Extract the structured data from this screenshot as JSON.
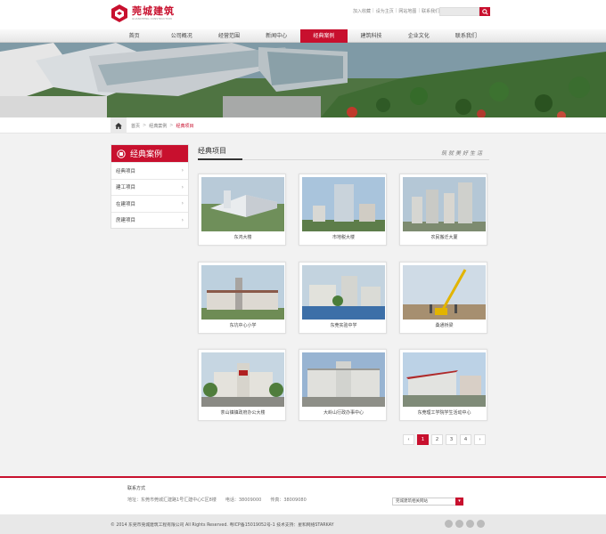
{
  "header": {
    "logo_title": "莞城建筑",
    "logo_subtitle": "GUANCHENG CONSTRUCTION",
    "toplinks": [
      "加入收藏",
      "设为主页",
      "网站地图",
      "联系我们"
    ],
    "search_placeholder": ""
  },
  "nav": {
    "items": [
      {
        "label": "首页",
        "active": false
      },
      {
        "label": "公司概况",
        "active": false
      },
      {
        "label": "经营范围",
        "active": false
      },
      {
        "label": "新闻中心",
        "active": false
      },
      {
        "label": "经典案例",
        "active": true
      },
      {
        "label": "建筑科技",
        "active": false
      },
      {
        "label": "企业文化",
        "active": false
      },
      {
        "label": "联系我们",
        "active": false
      }
    ]
  },
  "breadcrumb": {
    "home": "首页",
    "section": "经典案例",
    "current": "经典项目"
  },
  "sidebar": {
    "title": "经典案例",
    "items": [
      "经典项目",
      "建工项目",
      "在建项目",
      "房建项目"
    ]
  },
  "content": {
    "title": "经典项目",
    "motto": "筑就美好生活",
    "projects": [
      {
        "caption": "东鸿大楼"
      },
      {
        "caption": "市地税大楼"
      },
      {
        "caption": "农民搬迁大厦"
      },
      {
        "caption": "东坑中心小学"
      },
      {
        "caption": "东莞实验中学"
      },
      {
        "caption": "桑通桥梁"
      },
      {
        "caption": "茶山镇镇政府办公大楼"
      },
      {
        "caption": "大岭山行政办事中心"
      },
      {
        "caption": "东莞理工学院学生活动中心"
      }
    ],
    "pager": {
      "prev": "‹",
      "pages": [
        "1",
        "2",
        "3",
        "4"
      ],
      "current": "1",
      "next": "›"
    }
  },
  "footer": {
    "contact_title": "联系方式",
    "address": "地址：东莞市莞城汇建路1号汇建中心C区8楼",
    "phone": "电话：38009000",
    "fax": "传真：38009080",
    "links_select": "莞城建筑相关网站",
    "copyright": "© 2014 东莞市莞城建筑工程有限公司 All Rights Reserved. 粤ICP备15019052号-1  技术支持：星和网络STARKAY"
  },
  "colors": {
    "brand_red": "#c8102e",
    "bg_gray": "#f2f2f2"
  }
}
